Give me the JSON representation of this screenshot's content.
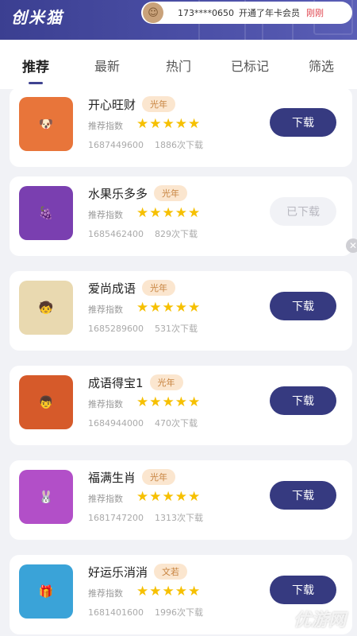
{
  "header": {
    "logo": "创米猫",
    "notice": {
      "phone": "173****0650",
      "message": "开通了年卡会员",
      "time": "刚刚"
    }
  },
  "tabs": [
    {
      "label": "推荐",
      "active": true
    },
    {
      "label": "最新",
      "active": false
    },
    {
      "label": "热门",
      "active": false
    },
    {
      "label": "已标记",
      "active": false
    },
    {
      "label": "筛选",
      "active": false
    }
  ],
  "list": {
    "rating_label": "推荐指数",
    "items": [
      {
        "name": "开心旺财",
        "tag": "光年",
        "stars": 5,
        "stars_text": "★★★★★",
        "id": "1687449600",
        "downloads": "1886次下载",
        "button": "下载",
        "downloaded": false,
        "icon_color": "#e8753a"
      },
      {
        "name": "水果乐多多",
        "tag": "光年",
        "stars": 5,
        "stars_text": "★★★★★",
        "id": "1685462400",
        "downloads": "829次下载",
        "button": "已下载",
        "downloaded": true,
        "icon_color": "#7a3fb0"
      },
      {
        "name": "爱尚成语",
        "tag": "光年",
        "stars": 5,
        "stars_text": "★★★★★",
        "id": "1685289600",
        "downloads": "531次下载",
        "button": "下载",
        "downloaded": false,
        "icon_color": "#e9d9b0"
      },
      {
        "name": "成语得宝1",
        "tag": "光年",
        "stars": 5,
        "stars_text": "★★★★★",
        "id": "1684944000",
        "downloads": "470次下载",
        "button": "下载",
        "downloaded": false,
        "icon_color": "#d65a2a"
      },
      {
        "name": "福满生肖",
        "tag": "光年",
        "stars": 5,
        "stars_text": "★★★★★",
        "id": "1681747200",
        "downloads": "1313次下载",
        "button": "下载",
        "downloaded": false,
        "icon_color": "#b24fc8"
      },
      {
        "name": "好运乐消消",
        "tag": "文若",
        "stars": 5,
        "stars_text": "★★★★★",
        "id": "1681401600",
        "downloads": "1996次下载",
        "button": "下载",
        "downloaded": false,
        "icon_color": "#3aa3d8"
      }
    ]
  },
  "watermark": "优游网"
}
